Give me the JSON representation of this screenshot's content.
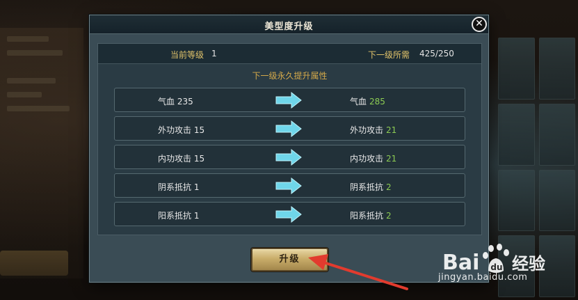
{
  "dialog": {
    "title": "美型度升级",
    "current_level_label": "当前等级",
    "current_level_value": "1",
    "next_level_label": "下一级所需",
    "next_level_value": "425/250",
    "section_title": "下一级永久提升属性",
    "stats": [
      {
        "name": "气血",
        "current": "235",
        "next": "285"
      },
      {
        "name": "外功攻击",
        "current": "15",
        "next": "21"
      },
      {
        "name": "内功攻击",
        "current": "15",
        "next": "21"
      },
      {
        "name": "阴系抵抗",
        "current": "1",
        "next": "2"
      },
      {
        "name": "阳系抵抗",
        "current": "1",
        "next": "2"
      }
    ],
    "upgrade_label": "升级",
    "close_symbol": "✕"
  },
  "watermark": {
    "logo": "Baidu经验",
    "url": "jingyan.baidu.com"
  },
  "colors": {
    "gold_label": "#e0c26a",
    "increase_green": "#8ccb53",
    "arrow_cyan": "#6fd6ea",
    "annotation_red": "#e23b2e"
  },
  "icons": {
    "row_arrow": "right-arrow-icon",
    "close": "close-icon"
  }
}
